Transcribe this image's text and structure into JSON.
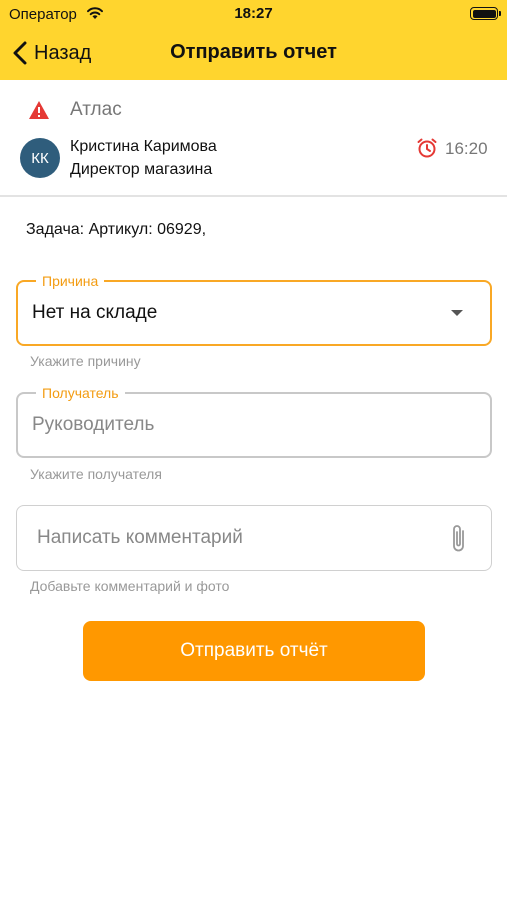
{
  "status_bar": {
    "carrier": "Оператор",
    "time": "18:27"
  },
  "nav": {
    "back_label": "Назад",
    "title": "Отправить отчет"
  },
  "store": {
    "name": "Атлас"
  },
  "person": {
    "initials": "КК",
    "name": "Кристина Каримова",
    "role": "Директор магазина",
    "time": "16:20"
  },
  "task": {
    "text": "Задача: Артикул: 06929,"
  },
  "reason": {
    "label": "Причина",
    "value": "Нет на складе",
    "helper": "Укажите причину"
  },
  "recipient": {
    "label": "Получатель",
    "placeholder": "Руководитель",
    "helper": "Укажите получателя"
  },
  "comment": {
    "placeholder": "Написать комментарий",
    "helper": "Добавьте комментарий и фото"
  },
  "submit": {
    "label": "Отправить отчёт"
  },
  "colors": {
    "header": "#FFD52E",
    "accent": "#F9A825",
    "button": "#FF9800",
    "alert": "#E53935",
    "avatar": "#2F5D7C"
  },
  "icons": {
    "back": "chevron-left-icon",
    "store": "warning-icon",
    "alarm": "alarm-clock-icon",
    "dropdown": "caret-down-icon",
    "attach": "paperclip-icon"
  }
}
